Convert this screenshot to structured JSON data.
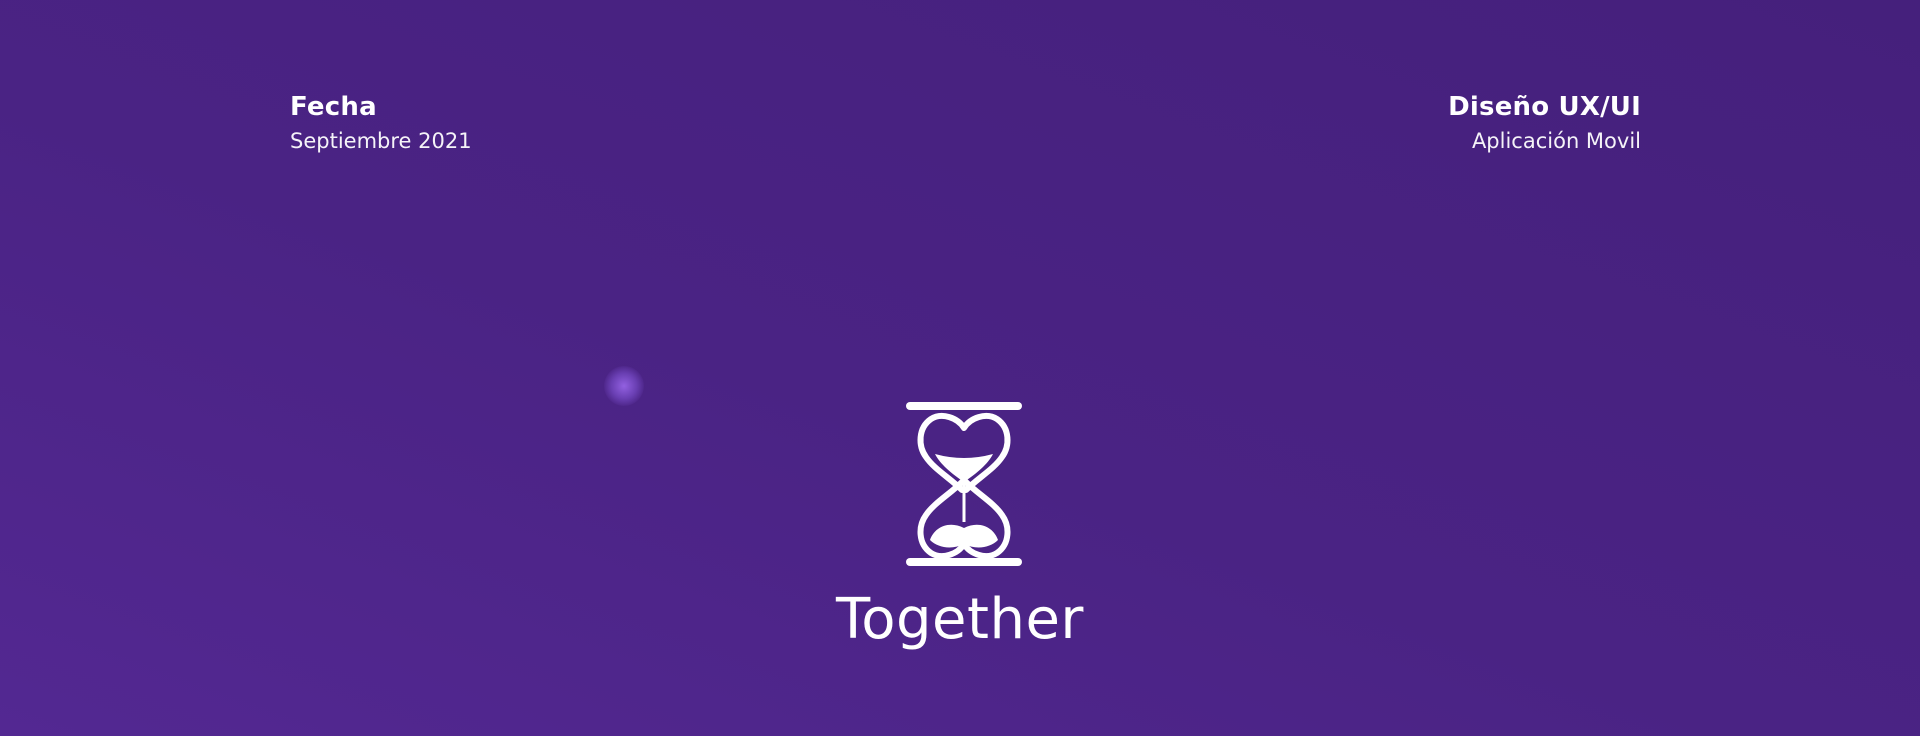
{
  "left_meta": {
    "label": "Fecha",
    "value": "Septiembre 2021"
  },
  "right_meta": {
    "label": "Diseño UX/UI",
    "value": "Aplicación Movil"
  },
  "brand": {
    "name": "Together",
    "logo_icon": "heart-hourglass-icon"
  },
  "colors": {
    "background_top": "#45207c",
    "background_bottom": "#532892",
    "text": "#ffffff",
    "glow": "#9664e6"
  }
}
